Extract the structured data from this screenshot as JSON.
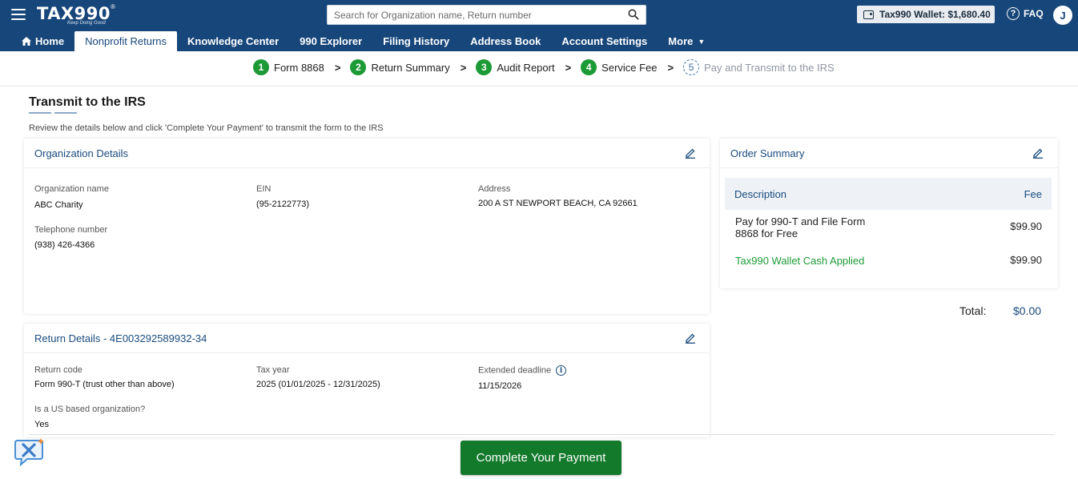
{
  "header": {
    "logo_text": "TAX990",
    "logo_reg": "®",
    "tagline": "Keep Doing Good",
    "search_placeholder": "Search for Organization name, Return number",
    "wallet_label": "Tax990 Wallet: $1,680.40",
    "faq_label": "FAQ",
    "avatar_initial": "J"
  },
  "nav": {
    "items": [
      {
        "label": "Home"
      },
      {
        "label": "Nonprofit Returns"
      },
      {
        "label": "Knowledge Center"
      },
      {
        "label": "990 Explorer"
      },
      {
        "label": "Filing History"
      },
      {
        "label": "Address Book"
      },
      {
        "label": "Account Settings"
      },
      {
        "label": "More"
      }
    ]
  },
  "stepper": {
    "steps": [
      {
        "num": "1",
        "label": "Form 8868"
      },
      {
        "num": "2",
        "label": "Return Summary"
      },
      {
        "num": "3",
        "label": "Audit Report"
      },
      {
        "num": "4",
        "label": "Service Fee"
      },
      {
        "num": "5",
        "label": "Pay and Transmit to the IRS"
      }
    ]
  },
  "page": {
    "title": "Transmit to the IRS",
    "subtitle": "Review the details below and click 'Complete Your Payment' to transmit the form to the IRS"
  },
  "org": {
    "title": "Organization Details",
    "name_label": "Organization name",
    "name_value": "ABC Charity",
    "ein_label": "EIN",
    "ein_value": "(95-2122773)",
    "address_label": "Address",
    "address_value": "200 A ST NEWPORT BEACH, CA 92661",
    "phone_label": "Telephone number",
    "phone_value": "(938) 426-4366"
  },
  "return": {
    "title": "Return Details - 4E003292589932-34",
    "code_label": "Return code",
    "code_value": "Form 990-T (trust other than above)",
    "tax_year_label": "Tax year",
    "tax_year_value": "2025 (01/01/2025 - 12/31/2025)",
    "deadline_label": "Extended deadline",
    "deadline_value": "11/15/2026",
    "us_label": "Is a US based organization?",
    "us_value": "Yes"
  },
  "order": {
    "title": "Order Summary",
    "col_description": "Description",
    "col_fee": "Fee",
    "rows": [
      {
        "description": "Pay for 990-T and File Form 8868 for Free",
        "fee": "$99.90"
      },
      {
        "description": "Tax990 Wallet Cash Applied",
        "fee": "$99.90"
      }
    ],
    "total_label": "Total:",
    "total_value": "$0.00"
  },
  "footer": {
    "pay_button": "Complete Your Payment"
  },
  "colors": {
    "header_bg": "#17467a",
    "accent_green": "#1c9a35",
    "button_green": "#137a2b",
    "link_blue": "#1a4b7d"
  }
}
